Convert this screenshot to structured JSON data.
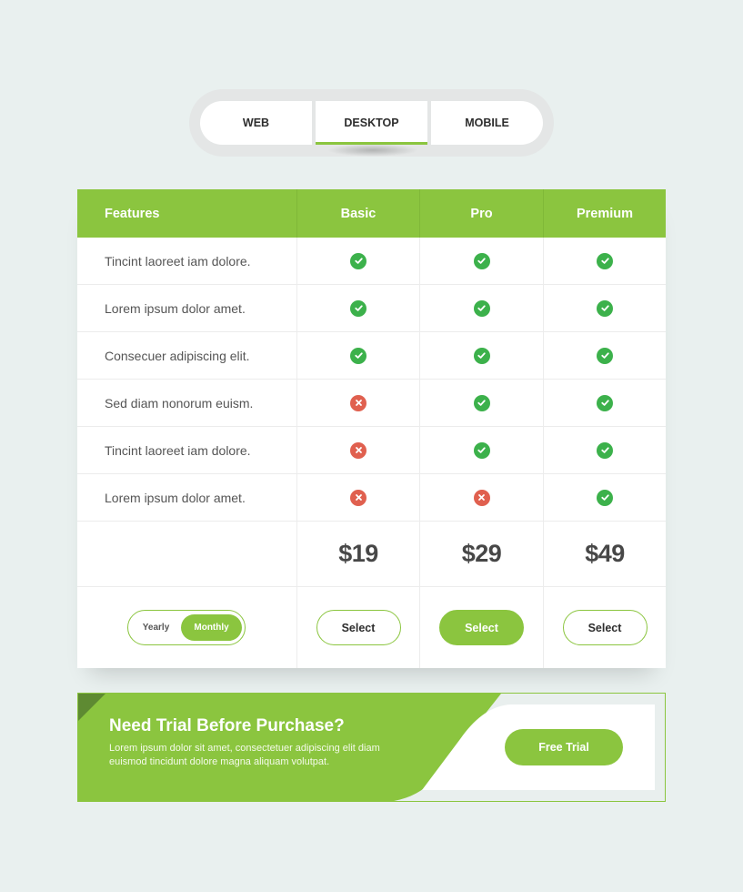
{
  "tabs": [
    {
      "label": "WEB",
      "active": false
    },
    {
      "label": "DESKTOP",
      "active": true
    },
    {
      "label": "MOBILE",
      "active": false
    }
  ],
  "table": {
    "headers": [
      "Features",
      "Basic",
      "Pro",
      "Premium"
    ],
    "features": [
      {
        "label": "Tincint laoreet iam dolore.",
        "basic": "check-icon",
        "pro": "check-icon",
        "premium": "check-icon"
      },
      {
        "label": "Lorem ipsum dolor amet.",
        "basic": "check-icon",
        "pro": "check-icon",
        "premium": "check-icon"
      },
      {
        "label": "Consecuer adipiscing elit.",
        "basic": "check-icon",
        "pro": "check-icon",
        "premium": "check-icon"
      },
      {
        "label": "Sed diam nonorum euism.",
        "basic": "cross-icon",
        "pro": "check-icon",
        "premium": "check-icon"
      },
      {
        "label": "Tincint laoreet iam dolore.",
        "basic": "cross-icon",
        "pro": "check-icon",
        "premium": "check-icon"
      },
      {
        "label": "Lorem ipsum dolor amet.",
        "basic": "cross-icon",
        "pro": "cross-icon",
        "premium": "check-icon"
      }
    ],
    "prices": [
      "$19",
      "$29",
      "$49"
    ],
    "billing_toggle": {
      "options": [
        "Yearly",
        "Monthly"
      ],
      "selected": "Monthly"
    },
    "select_labels": [
      "Select",
      "Select",
      "Select"
    ],
    "highlighted_plan": "Pro"
  },
  "banner": {
    "title": "Need Trial Before Purchase?",
    "text": "Lorem ipsum dolor sit amet, consectetuer adipiscing elit diam euismod tincidunt dolore magna aliquam volutpat.",
    "button_label": "Free Trial"
  },
  "colors": {
    "accent": "#8bc53f",
    "check": "#3cb14b",
    "cross": "#e0604f",
    "background": "#e9f0ef"
  }
}
